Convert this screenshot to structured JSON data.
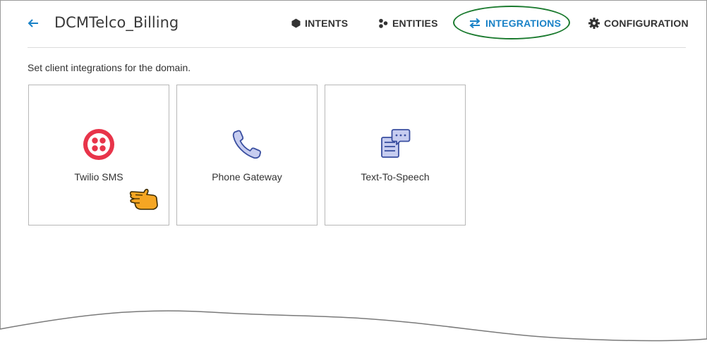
{
  "header": {
    "title": "DCMTelco_Billing",
    "nav": [
      {
        "label": "INTENTS",
        "icon": "hexagon-icon"
      },
      {
        "label": "ENTITIES",
        "icon": "entities-icon"
      },
      {
        "label": "INTEGRATIONS",
        "icon": "swap-arrows-icon",
        "active": true
      },
      {
        "label": "CONFIGURATION",
        "icon": "gear-icon"
      }
    ]
  },
  "main": {
    "subtitle": "Set client integrations for the domain.",
    "cards": [
      {
        "label": "Twilio SMS",
        "icon": "twilio-icon"
      },
      {
        "label": "Phone Gateway",
        "icon": "phone-icon"
      },
      {
        "label": "Text-To-Speech",
        "icon": "speech-document-icon"
      }
    ]
  },
  "colors": {
    "accent": "#1a82c7",
    "highlight": "#1a7a2e",
    "twilio": "#e8344a",
    "icon_fill": "#c7cdf0",
    "icon_stroke": "#3a4fa0"
  }
}
